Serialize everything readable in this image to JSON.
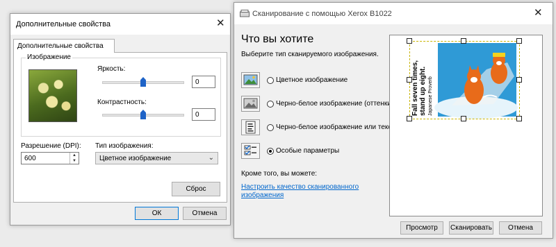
{
  "left_dialog": {
    "title": "Дополнительные свойства",
    "tab_label": "Дополнительные свойства",
    "image_group_label": "Изображение",
    "brightness_label": "Яркость:",
    "brightness_value": "0",
    "contrast_label": "Контрастность:",
    "contrast_value": "0",
    "resolution_label": "Разрешение (DPI):",
    "resolution_value": "600",
    "image_type_label": "Тип изображения:",
    "image_type_value": "Цветное изображение",
    "reset_label": "Сброс",
    "ok_label": "ОК",
    "cancel_label": "Отмена"
  },
  "right_dialog": {
    "title": "Сканирование с помощью Xerox B1022",
    "heading": "Что вы хотите",
    "subtitle": "Выберите тип сканируемого изображения.",
    "options": [
      {
        "label": "Цветное изображение",
        "selected": false,
        "icon": "color-photo-icon"
      },
      {
        "label": "Черно-белое изображение (оттенки",
        "selected": false,
        "icon": "grayscale-photo-icon"
      },
      {
        "label": "Черно-белое изображение или текс",
        "selected": false,
        "icon": "text-document-icon"
      },
      {
        "label": "Особые параметры",
        "selected": true,
        "icon": "custom-settings-icon"
      }
    ],
    "also_label": "Кроме того, вы можете:",
    "link_label": "Настроить качество сканированного изображения",
    "preview_text": {
      "line1": "Fall seven times,",
      "line2": "stand up eight.",
      "line3": "Japanese Proverb"
    },
    "preview_button": "Просмотр",
    "scan_button": "Сканировать",
    "cancel_button": "Отмена"
  },
  "colors": {
    "accent": "#0078d7",
    "link": "#0066cc",
    "slider": "#1e63c7",
    "selection": "#c8b400"
  }
}
